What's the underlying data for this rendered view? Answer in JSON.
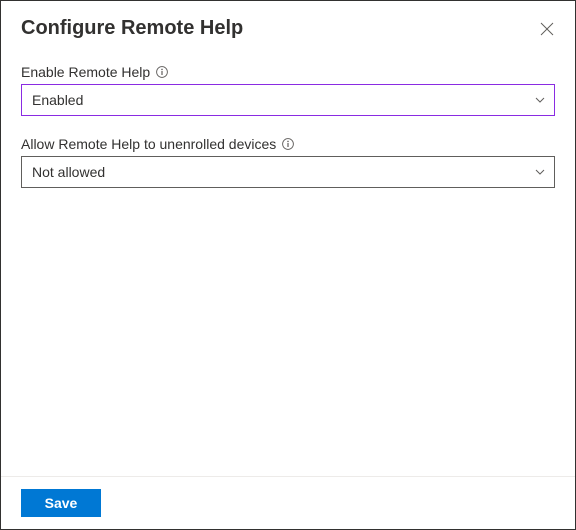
{
  "header": {
    "title": "Configure Remote Help"
  },
  "fields": {
    "enableRemoteHelp": {
      "label": "Enable Remote Help",
      "value": "Enabled"
    },
    "allowUnenrolled": {
      "label": "Allow Remote Help to unenrolled devices",
      "value": "Not allowed"
    }
  },
  "footer": {
    "saveLabel": "Save"
  }
}
